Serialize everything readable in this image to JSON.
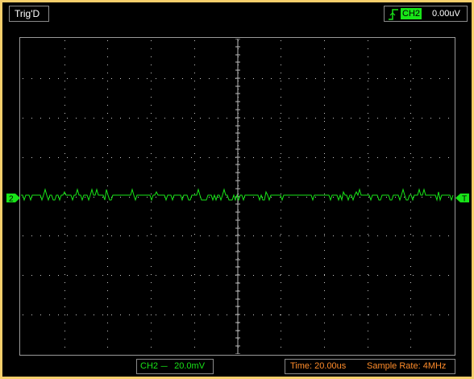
{
  "header": {
    "trigger_status": "Trig'D",
    "trigger_channel": "CH2",
    "trigger_level": "0.00uV",
    "trigger_edge_icon": "rising-edge-icon"
  },
  "markers": {
    "channel_marker_label": "2",
    "trigger_marker_label": "T"
  },
  "footer": {
    "channel_label": "CH2",
    "coupling_symbol": "----",
    "volts_per_div": "20.0mV",
    "time_label": "Time: 20.00us",
    "sample_rate_label": "Sample Rate: 4MHz"
  },
  "colors": {
    "frame": "#f6cf6c",
    "trace": "#18e418",
    "grid_dots": "#c8c8c8",
    "time_text": "#ff8c2a"
  }
}
